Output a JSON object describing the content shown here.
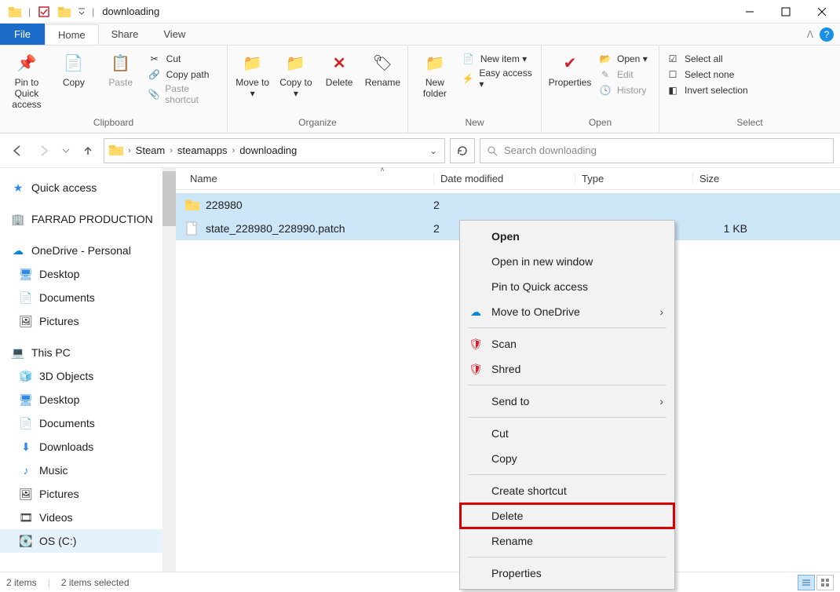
{
  "window": {
    "title": "downloading"
  },
  "tabs": {
    "file": "File",
    "home": "Home",
    "share": "Share",
    "view": "View"
  },
  "ribbon": {
    "clipboard": {
      "label": "Clipboard",
      "pin": "Pin to Quick access",
      "copy": "Copy",
      "paste": "Paste",
      "cut": "Cut",
      "copy_path": "Copy path",
      "paste_shortcut": "Paste shortcut"
    },
    "organize": {
      "label": "Organize",
      "move_to": "Move to ▾",
      "copy_to": "Copy to ▾",
      "delete": "Delete",
      "rename": "Rename"
    },
    "new": {
      "label": "New",
      "new_folder": "New folder",
      "new_item": "New item ▾",
      "easy_access": "Easy access ▾"
    },
    "open": {
      "label": "Open",
      "properties": "Properties",
      "open": "Open ▾",
      "edit": "Edit",
      "history": "History"
    },
    "select": {
      "label": "Select",
      "select_all": "Select all",
      "select_none": "Select none",
      "invert": "Invert selection"
    }
  },
  "breadcrumbs": {
    "a": "Steam",
    "b": "steamapps",
    "c": "downloading"
  },
  "search": {
    "placeholder": "Search downloading"
  },
  "columns": {
    "name": "Name",
    "date": "Date modified",
    "type": "Type",
    "size": "Size"
  },
  "files": [
    {
      "name": "228980",
      "date": "2",
      "type": "",
      "size": "",
      "kind": "folder"
    },
    {
      "name": "state_228980_228990.patch",
      "date": "2",
      "type": "",
      "size": "1 KB",
      "kind": "file"
    }
  ],
  "sidebar": {
    "quick_access": "Quick access",
    "farrad": "FARRAD PRODUCTION",
    "onedrive": "OneDrive - Personal",
    "od_desktop": "Desktop",
    "od_documents": "Documents",
    "od_pictures": "Pictures",
    "this_pc": "This PC",
    "pc_3d": "3D Objects",
    "pc_desktop": "Desktop",
    "pc_documents": "Documents",
    "pc_downloads": "Downloads",
    "pc_music": "Music",
    "pc_pictures": "Pictures",
    "pc_videos": "Videos",
    "pc_os": "OS (C:)"
  },
  "context_menu": {
    "open": "Open",
    "open_new": "Open in new window",
    "pin_qa": "Pin to Quick access",
    "move_od": "Move to OneDrive",
    "scan": "Scan",
    "shred": "Shred",
    "send_to": "Send to",
    "cut": "Cut",
    "copy": "Copy",
    "create_shortcut": "Create shortcut",
    "delete": "Delete",
    "rename": "Rename",
    "properties": "Properties"
  },
  "status": {
    "count": "2 items",
    "selected": "2 items selected"
  }
}
